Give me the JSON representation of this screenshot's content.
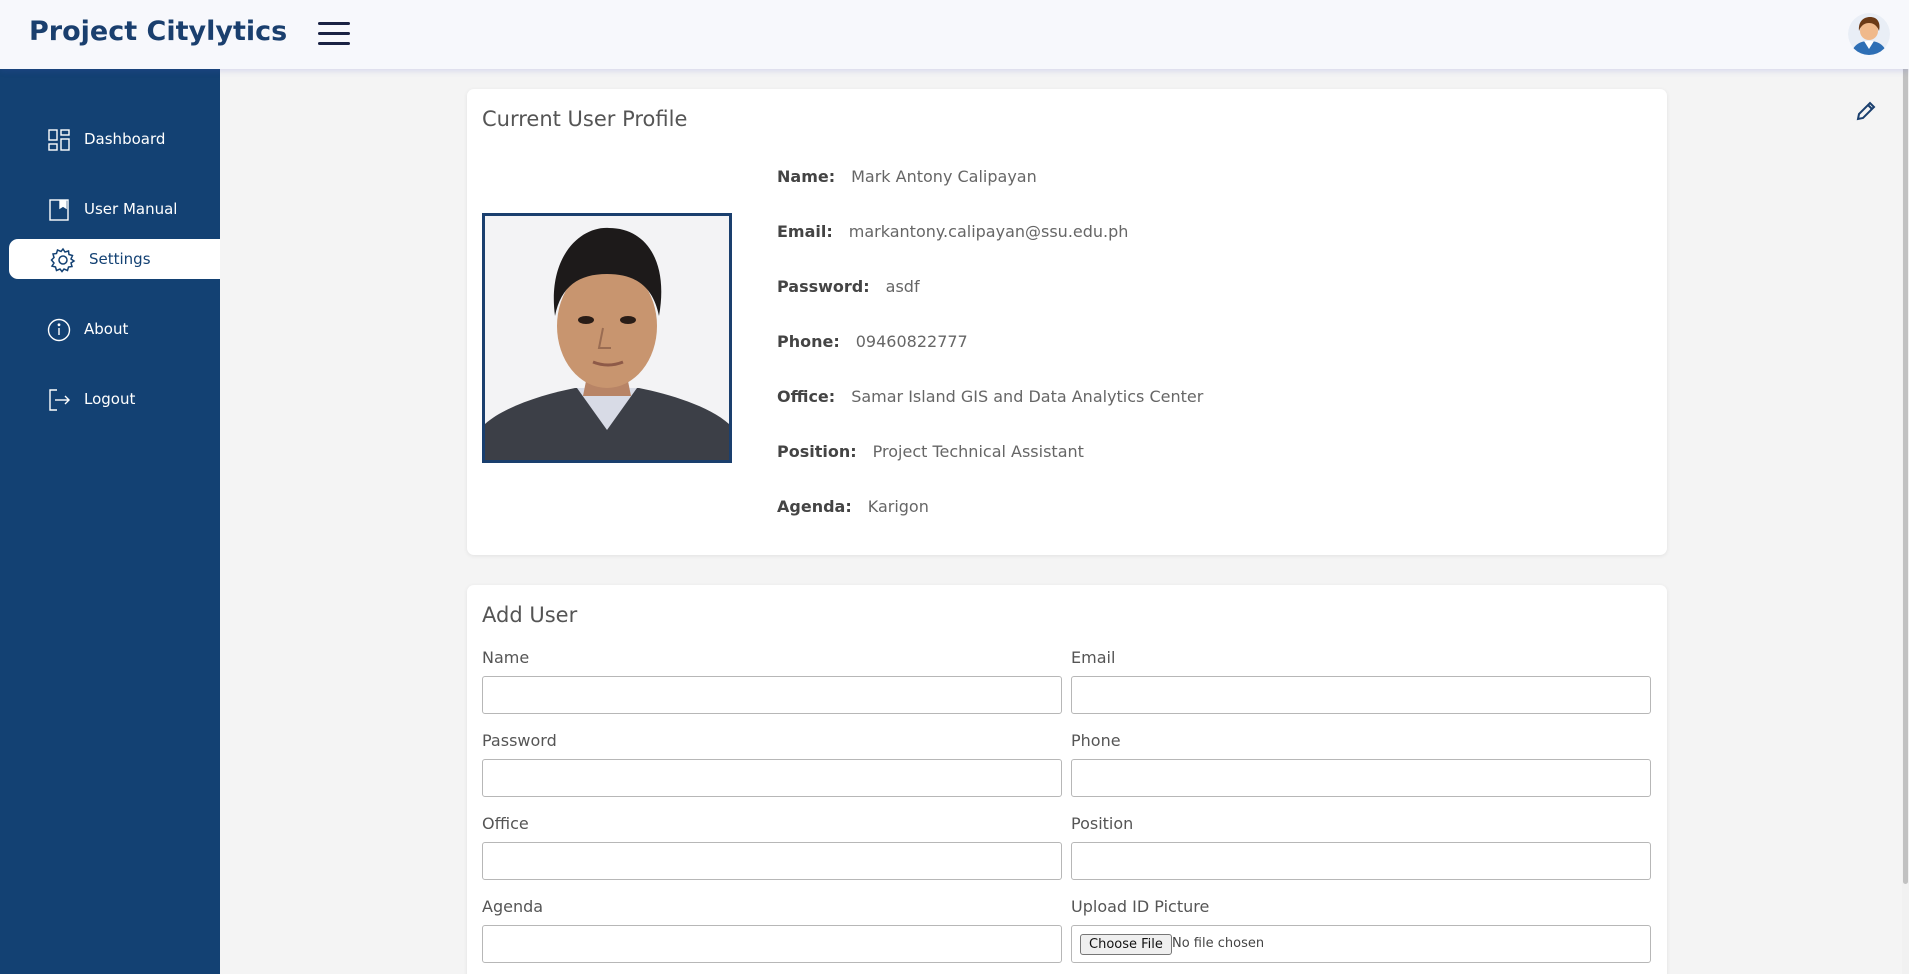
{
  "app": {
    "title": "Project Citylytics"
  },
  "sidebar": {
    "items": [
      {
        "label": "Dashboard",
        "icon": "dashboard-grid-icon"
      },
      {
        "label": "User Manual",
        "icon": "book-icon"
      },
      {
        "label": "Settings",
        "icon": "gear-icon",
        "active": true
      },
      {
        "label": "About",
        "icon": "info-icon"
      },
      {
        "label": "Logout",
        "icon": "logout-icon"
      }
    ]
  },
  "profile": {
    "title": "Current User Profile",
    "fields": [
      {
        "key": "Name:",
        "value": "Mark Antony Calipayan"
      },
      {
        "key": "Email:",
        "value": "markantony.calipayan@ssu.edu.ph"
      },
      {
        "key": "Password:",
        "value": "asdf"
      },
      {
        "key": "Phone:",
        "value": "09460822777"
      },
      {
        "key": "Office:",
        "value": "Samar Island GIS and Data Analytics Center"
      },
      {
        "key": "Position:",
        "value": "Project Technical Assistant"
      },
      {
        "key": "Agenda:",
        "value": "Karigon"
      }
    ]
  },
  "add_user": {
    "title": "Add User",
    "fields": [
      {
        "label": "Name",
        "value": ""
      },
      {
        "label": "Email",
        "value": ""
      },
      {
        "label": "Password",
        "value": ""
      },
      {
        "label": "Phone",
        "value": ""
      },
      {
        "label": "Office",
        "value": ""
      },
      {
        "label": "Position",
        "value": ""
      },
      {
        "label": "Agenda",
        "value": ""
      },
      {
        "label": "Upload ID Picture",
        "button": "Choose File",
        "status": "No file chosen"
      }
    ]
  },
  "colors": {
    "primary": "#134173",
    "brand_text": "#1a3f6e",
    "background": "#f4f4f4"
  }
}
